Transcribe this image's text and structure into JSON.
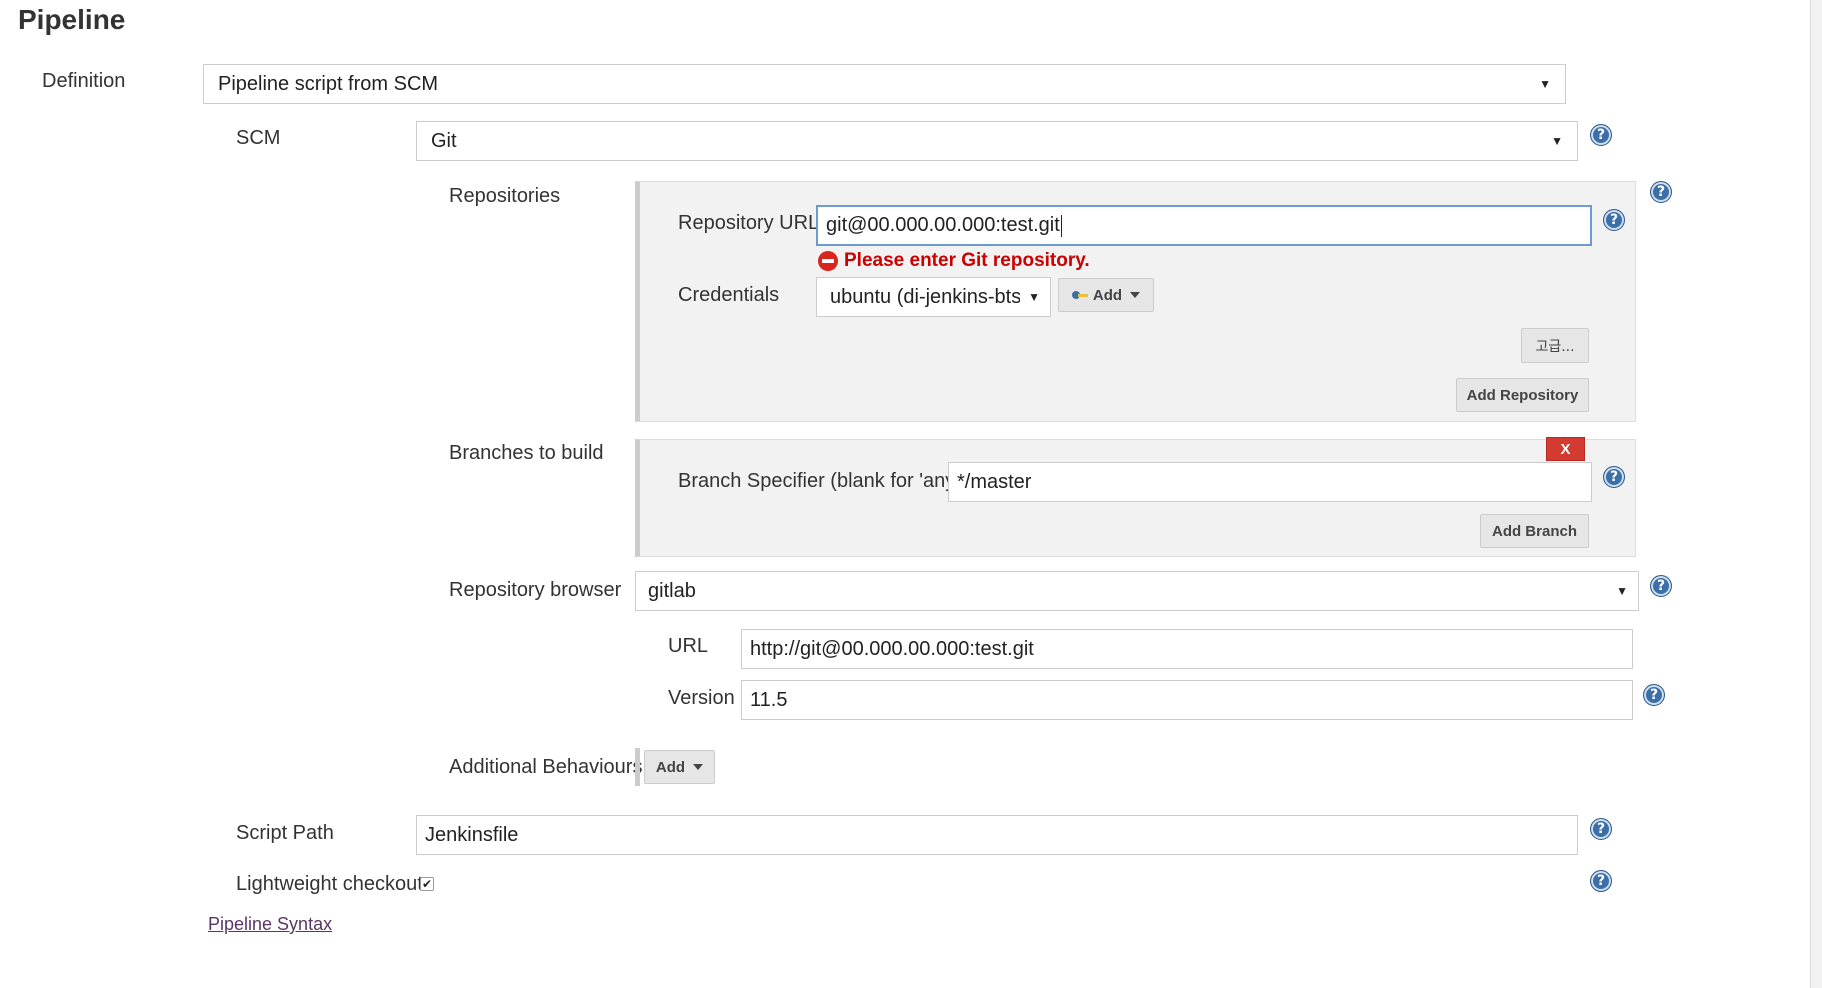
{
  "section_title": "Pipeline",
  "definition": {
    "label": "Definition",
    "value": "Pipeline script from SCM"
  },
  "scm": {
    "label": "SCM",
    "value": "Git"
  },
  "repositories": {
    "label": "Repositories",
    "url_label": "Repository URL",
    "url_value": "git@00.000.00.000:test.git",
    "error": "Please enter Git repository.",
    "credentials_label": "Credentials",
    "credentials_value": "ubuntu (di-jenkins-btsw)",
    "add_label": "Add",
    "advanced_label": "고급...",
    "add_repository_label": "Add Repository"
  },
  "branches": {
    "label": "Branches to build",
    "delete_label": "X",
    "specifier_label": "Branch Specifier (blank for 'any')",
    "specifier_value": "*/master",
    "add_branch_label": "Add Branch"
  },
  "repository_browser": {
    "label": "Repository browser",
    "value": "gitlab",
    "url_label": "URL",
    "url_value": "http://git@00.000.00.000:test.git",
    "version_label": "Version",
    "version_value": "11.5"
  },
  "additional_behaviours": {
    "label": "Additional Behaviours",
    "add_label": "Add"
  },
  "script_path": {
    "label": "Script Path",
    "value": "Jenkinsfile"
  },
  "lightweight_checkout": {
    "label": "Lightweight checkout",
    "checked": true,
    "mark": "✔"
  },
  "pipeline_syntax_link": "Pipeline Syntax",
  "help_glyph": "?",
  "dropdown_arrow": "▼",
  "colors": {
    "error": "#cc0000",
    "help": "#3c6fa8",
    "delete": "#d33a32",
    "link": "#5c3566"
  }
}
